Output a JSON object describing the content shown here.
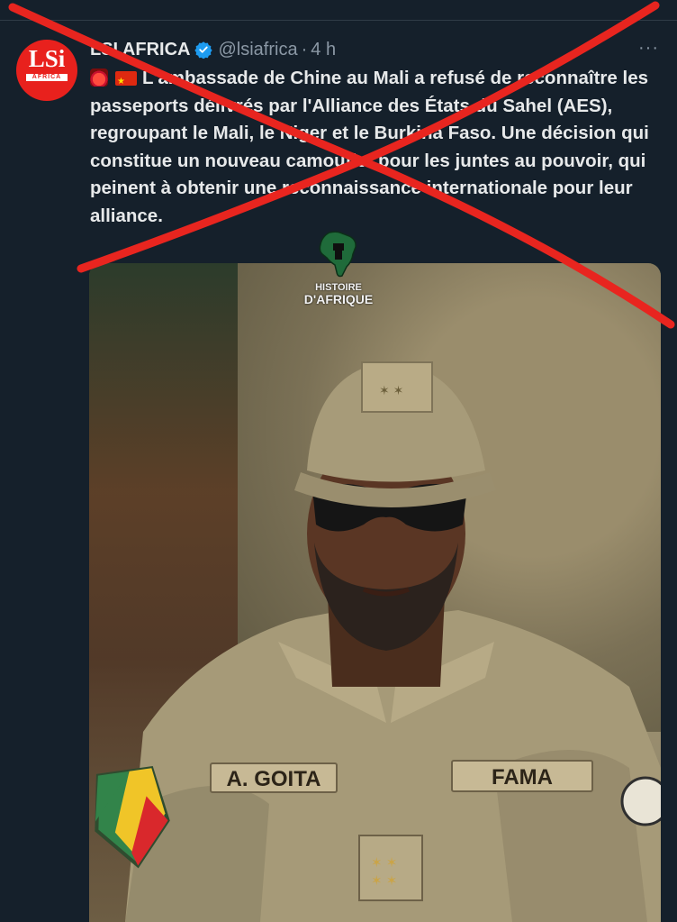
{
  "tweet": {
    "avatar": {
      "logo_text": "LSi",
      "logo_subtext": "AFRICA"
    },
    "display_name": "LSI AFRICA",
    "handle": "@lsiafrica",
    "separator": "·",
    "time": "4 h",
    "more": "···",
    "emoji": [
      "police-siren",
      "flag-china"
    ],
    "text": "L'ambassade de Chine au Mali a refusé de reconnaître les passeports délivrés par l'Alliance des États du Sahel (AES), regroupant le Mali, le Niger et le Burkina Faso. Une décision qui constitue un nouveau camouflet pour les juntes au pouvoir, qui peinent à obtenir une reconnaissance internationale pour leur alliance."
  },
  "media": {
    "watermark": {
      "line1": "HISTOIRE",
      "line2": "D'AFRIQUE"
    },
    "name_tape_left": "A. GOITA",
    "name_tape_right": "FAMA"
  },
  "overlay": {
    "cross_color": "#e8251f"
  }
}
